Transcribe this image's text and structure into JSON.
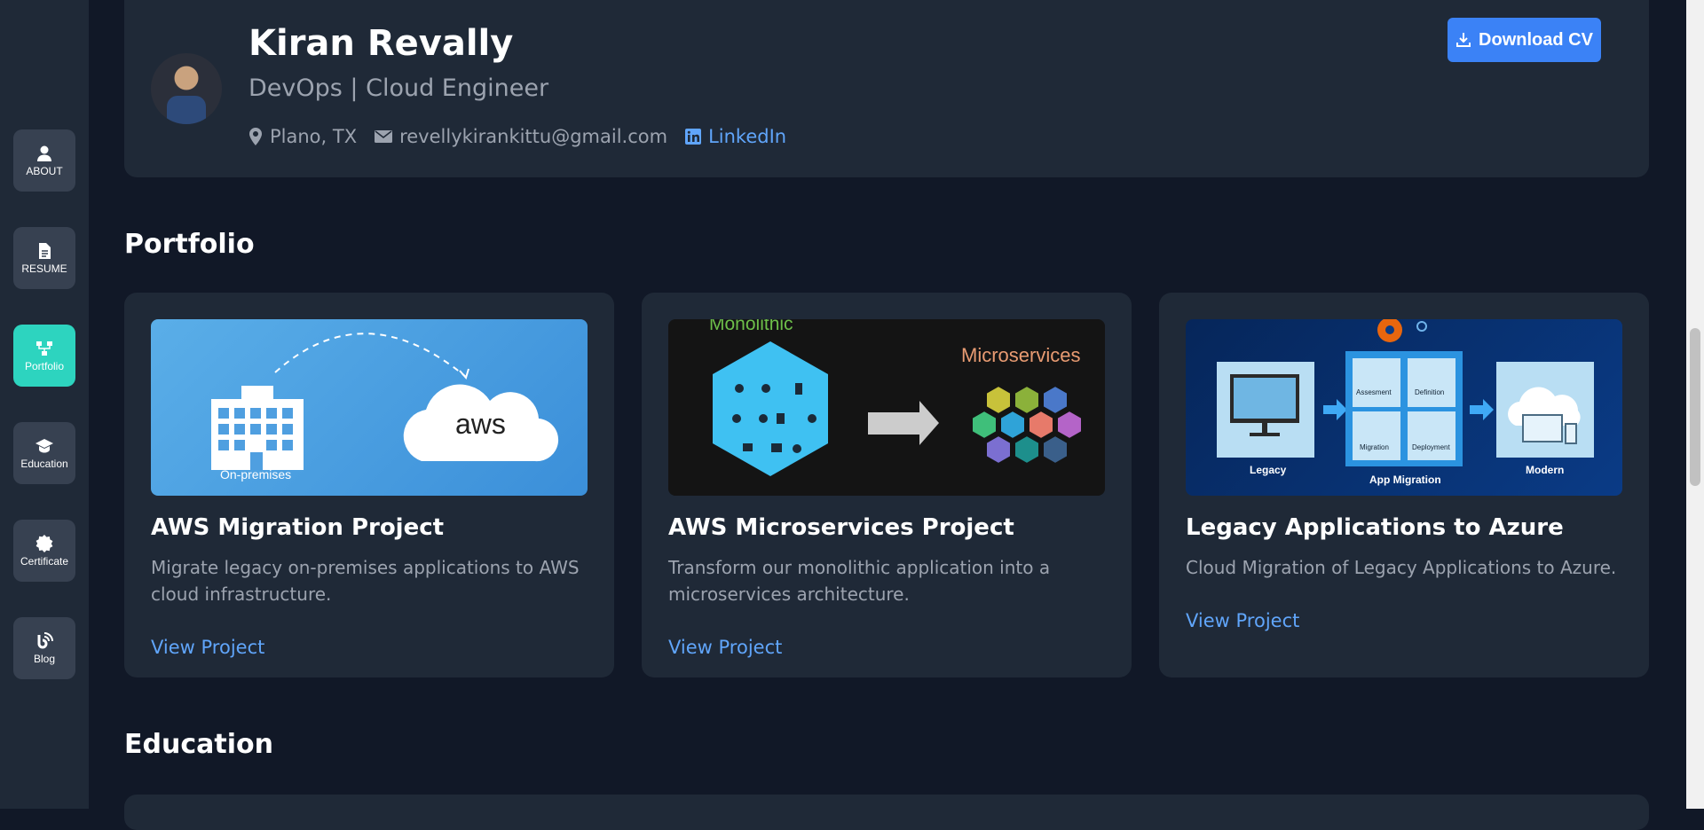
{
  "sidebar": {
    "items": [
      {
        "label": "ABOUT",
        "icon": "user-icon"
      },
      {
        "label": "RESUME",
        "icon": "document-icon"
      },
      {
        "label": "Portfolio",
        "icon": "sitemap-icon",
        "active": true
      },
      {
        "label": "Education",
        "icon": "graduation-cap-icon"
      },
      {
        "label": "Certificate",
        "icon": "certificate-icon"
      },
      {
        "label": "Blog",
        "icon": "blog-icon"
      }
    ]
  },
  "header": {
    "name": "Kiran Revally",
    "role": "DevOps | Cloud Engineer",
    "location": "Plano, TX",
    "email": "revellykirankittu@gmail.com",
    "linkedin": "LinkedIn",
    "download_label": "Download CV"
  },
  "portfolio": {
    "heading": "Portfolio",
    "projects": [
      {
        "title": "AWS Migration Project",
        "description": "Migrate legacy on-premises applications to AWS cloud infrastructure.",
        "link": "View Project",
        "image_labels": {
          "left": "On-premises",
          "right": "aws"
        }
      },
      {
        "title": "AWS Microservices Project",
        "description": "Transform our monolithic application into a microservices architecture.",
        "link": "View Project",
        "image_labels": {
          "left": "Monolithic",
          "right": "Microservices"
        }
      },
      {
        "title": "Legacy Applications to Azure",
        "description": "Cloud Migration of Legacy Applications to Azure.",
        "link": "View Project",
        "image_labels": {
          "legacy": "Legacy",
          "center": "App Migration",
          "modern": "Modern",
          "b1": "Assesment",
          "b2": "Definition",
          "b3": "Migration",
          "b4": "Deployment"
        }
      }
    ]
  },
  "education": {
    "heading": "Education"
  },
  "colors": {
    "accent": "#3b82f6",
    "active_nav": "#2dd4bf",
    "link": "#60a5fa",
    "background": "#111827",
    "card": "#1f2937"
  }
}
